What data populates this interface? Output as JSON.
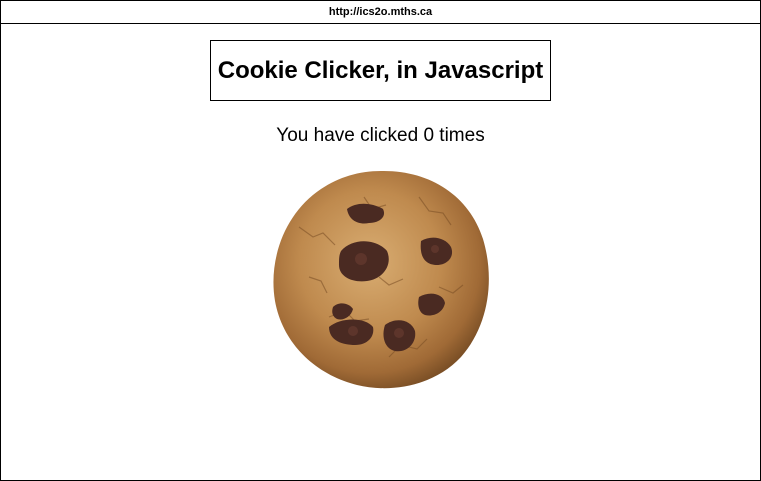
{
  "browser": {
    "url": "http://ics2o.mths.ca"
  },
  "page": {
    "title": "Cookie Clicker, in Javascript",
    "counter_text": "You have clicked 0 times"
  },
  "cookie": {
    "icon": "cookie-icon",
    "colors": {
      "dough_dark": "#8a5a2b",
      "dough_mid": "#b57f45",
      "dough_light": "#d2a46a",
      "chocolate": "#4a2a22",
      "chocolate_light": "#6b3d32"
    }
  }
}
